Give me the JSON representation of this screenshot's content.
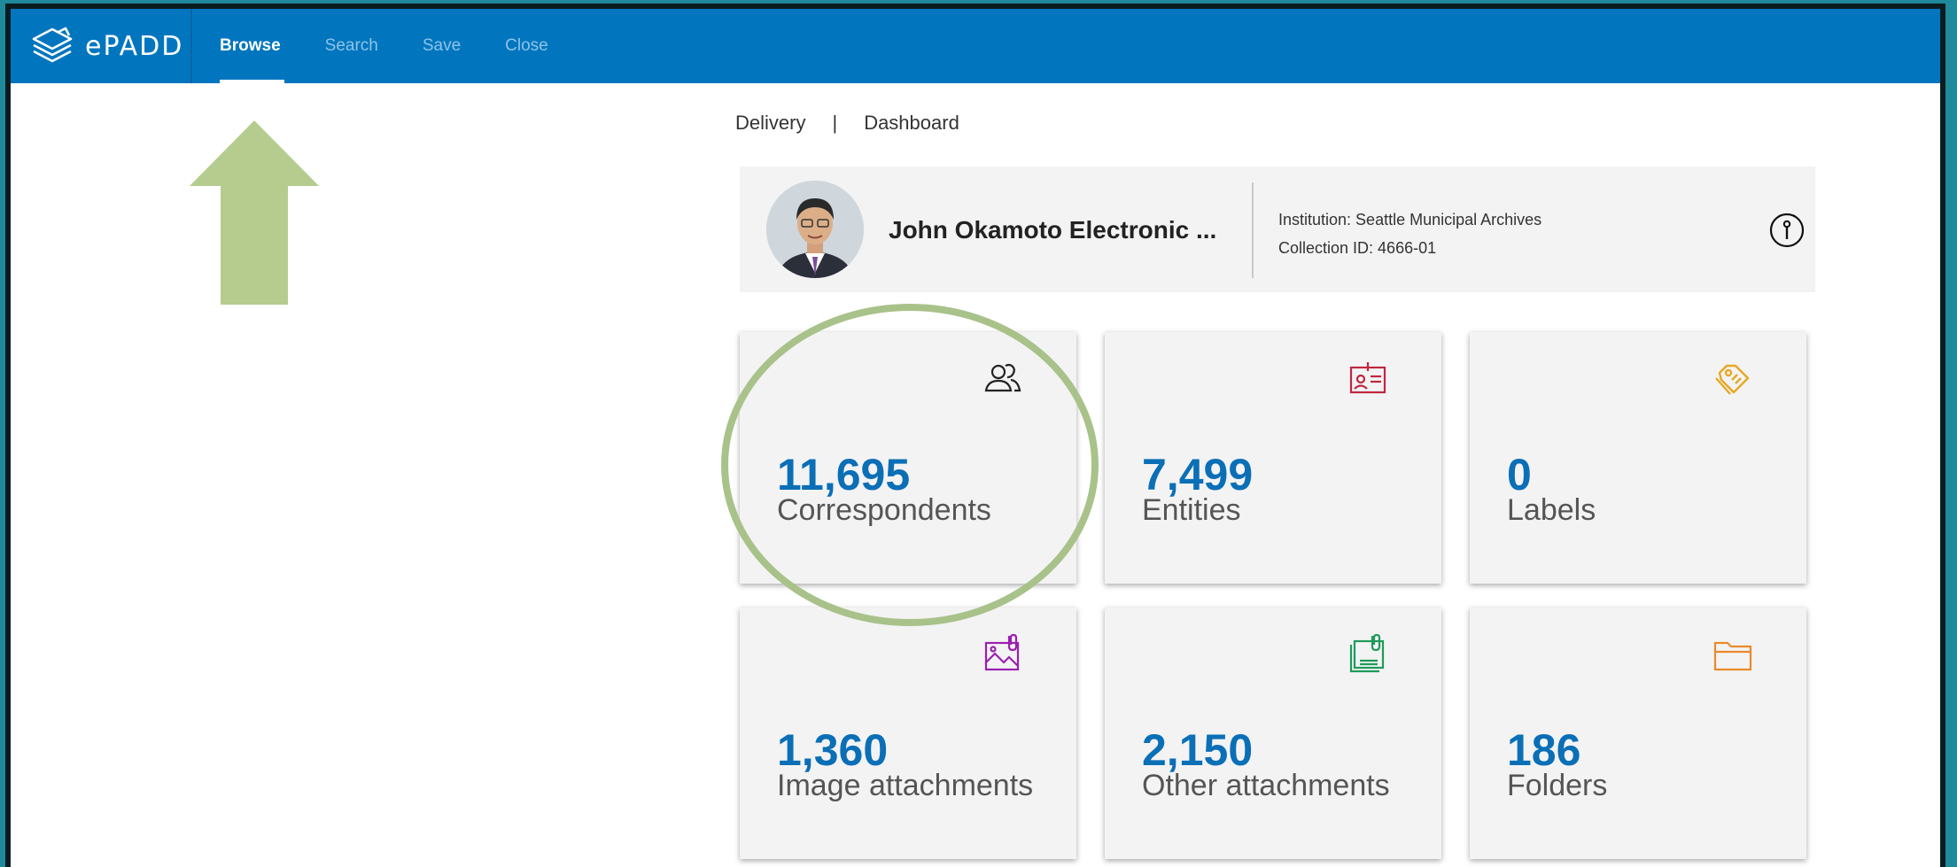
{
  "app": {
    "logo_text": "ePADD"
  },
  "nav": [
    {
      "label": "Browse",
      "active": true
    },
    {
      "label": "Search",
      "active": false
    },
    {
      "label": "Save",
      "active": false
    },
    {
      "label": "Close",
      "active": false
    }
  ],
  "breadcrumb": {
    "first": "Delivery",
    "separator": "|",
    "second": "Dashboard"
  },
  "collection": {
    "title": "John Okamoto Electronic ...",
    "institution": "Institution: Seattle Municipal Archives",
    "collection_id": "Collection ID: 4666-01"
  },
  "tiles": [
    {
      "value": "11,695",
      "label": "Correspondents",
      "icon": "correspondents-icon",
      "color": "#222222"
    },
    {
      "value": "7,499",
      "label": "Entities",
      "icon": "entities-icon",
      "color": "#c0273f"
    },
    {
      "value": "0",
      "label": "Labels",
      "icon": "labels-icon",
      "color": "#e6a823"
    },
    {
      "value": "1,360",
      "label": "Image attachments",
      "icon": "image-attachments-icon",
      "color": "#9b1fb0"
    },
    {
      "value": "2,150",
      "label": "Other attachments",
      "icon": "other-attachments-icon",
      "color": "#1f9a5a"
    },
    {
      "value": "186",
      "label": "Folders",
      "icon": "folders-icon",
      "color": "#ea8a2a"
    }
  ],
  "annotations": {
    "arrow_color": "#b5cc8e",
    "circle_color": "#a8c28a"
  },
  "colors": {
    "brand": "#0176bf",
    "value_text": "#0b6fb6"
  }
}
